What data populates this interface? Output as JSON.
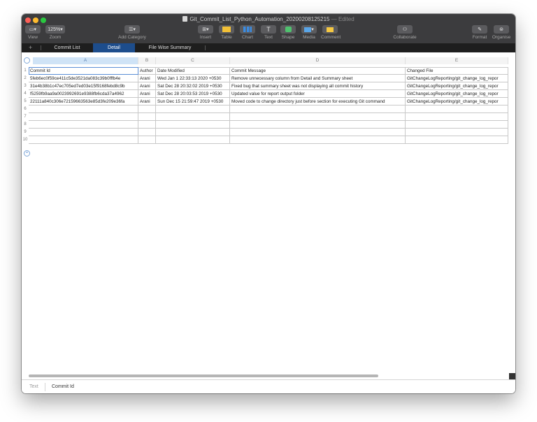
{
  "window": {
    "title": "Git_Commit_List_Python_Automation_20200208125215",
    "edited_suffix": "— Edited"
  },
  "toolbar": {
    "view": {
      "label": "View",
      "icon": "sidebar-icon"
    },
    "zoom": {
      "label": "Zoom",
      "value": "125%"
    },
    "add_category": {
      "label": "Add Category",
      "icon": "list-icon"
    },
    "insert": {
      "label": "Insert",
      "icon": "insert-icon"
    },
    "table": {
      "label": "Table",
      "icon": "table-icon",
      "color": "#f2c037"
    },
    "chart": {
      "label": "Chart",
      "icon": "chart-icon",
      "color": "#3b8be0"
    },
    "text": {
      "label": "Text",
      "icon": "text-icon",
      "glyph": "T"
    },
    "shape": {
      "label": "Shape",
      "icon": "shape-icon",
      "color": "#4fc26e"
    },
    "media": {
      "label": "Media",
      "icon": "media-icon",
      "color": "#5aa6e8"
    },
    "comment": {
      "label": "Comment",
      "icon": "comment-icon",
      "color": "#f5c842"
    },
    "collaborate": {
      "label": "Collaborate",
      "icon": "collaborate-icon"
    },
    "format": {
      "label": "Format",
      "icon": "paintbrush-icon"
    },
    "organise": {
      "label": "Organise",
      "icon": "organise-icon"
    }
  },
  "sheet_tabs": {
    "add": "+",
    "tabs": [
      {
        "label": "Commit List",
        "active": false
      },
      {
        "label": "Detail",
        "active": true
      },
      {
        "label": "File Wise Summary",
        "active": false
      }
    ]
  },
  "table": {
    "column_letters": [
      "A",
      "B",
      "C",
      "D",
      "E"
    ],
    "row_numbers": [
      "1",
      "2",
      "3",
      "4",
      "5",
      "6",
      "7",
      "8",
      "9",
      "10"
    ],
    "rows": [
      [
        "Commit Id",
        "Author",
        "Date Modified",
        "Commit Message",
        "Changed File"
      ],
      [
        "5feb6ec0f59ce411c5de3521da083c39b0fffb4e",
        "Arani",
        "Wed Jan 1 22:33:13 2020 +0530",
        "Remove unnecessary column from Detail and Summary sheet",
        "GitChangeLogReporting/git_change_log_repor"
      ],
      [
        "31e4b38b1c47ec705ed7ed03e15f9168febd8c9b",
        "Arani",
        "Sat Dec 28 20:32:02 2019 +0530",
        "Fixed bug that summary sheet was not displaying all commit history",
        "GitChangeLogReporting/git_change_log_repor"
      ],
      [
        "f5259fb9aa9a0023992691e9388fb6cda37a4962",
        "Arani",
        "Sat Dec 28 20:03:53 2019 +0530",
        "Updated value for report output folder",
        "GitChangeLogReporting/git_change_log_repor"
      ],
      [
        "22111a840c306e72159663563e85d3fe209e36fa",
        "Arani",
        "Sun Dec 15 21:59:47 2019 +0530",
        "Moved code to change directory just before section for executing Git command",
        "GitChangeLogReporting/git_change_log_repor"
      ],
      [
        "",
        "",
        "",
        "",
        ""
      ],
      [
        "",
        "",
        "",
        "",
        ""
      ],
      [
        "",
        "",
        "",
        "",
        ""
      ],
      [
        "",
        "",
        "",
        "",
        ""
      ],
      [
        "",
        "",
        "",
        "",
        ""
      ]
    ]
  },
  "statusbar": {
    "label": "Text",
    "value": "Commit Id"
  }
}
